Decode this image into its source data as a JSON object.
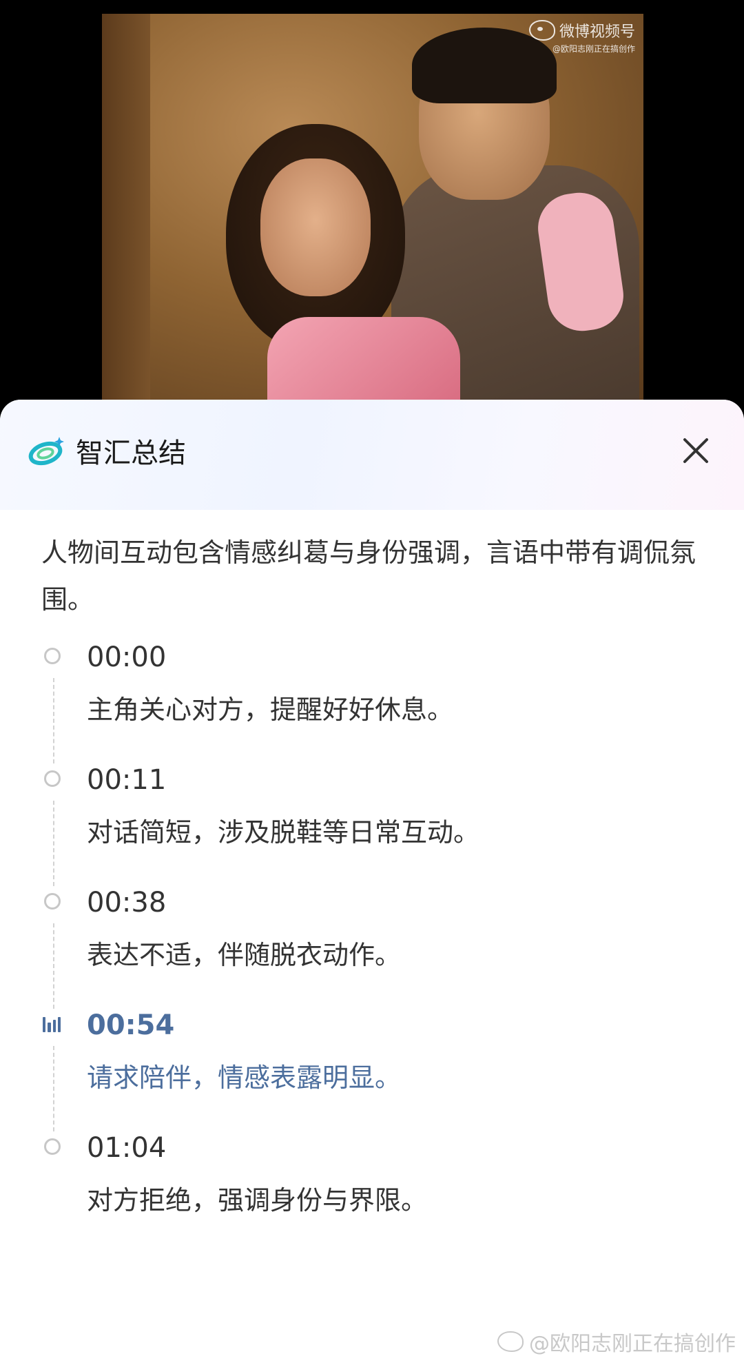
{
  "video": {
    "watermark_brand": "微博视频号",
    "watermark_handle": "@欧阳志刚正在搞创作"
  },
  "sheet": {
    "title": "智汇总结",
    "summary": "人物间互动包含情感纠葛与身份强调，言语中带有调侃氛围。",
    "timeline": [
      {
        "time": "00:00",
        "text": "主角关心对方，提醒好好休息。"
      },
      {
        "time": "00:11",
        "text": "对话简短，涉及脱鞋等日常互动。"
      },
      {
        "time": "00:38",
        "text": "表达不适，伴随脱衣动作。"
      },
      {
        "time": "00:54",
        "text": "请求陪伴，情感表露明显。"
      },
      {
        "time": "01:04",
        "text": "对方拒绝，强调身份与界限。"
      }
    ],
    "active_index": 3
  },
  "footer": {
    "watermark": "@欧阳志刚正在搞创作"
  },
  "colors": {
    "accent": "#4c6e9d",
    "logo_primary": "#1fb5c9"
  },
  "icons": {
    "logo": "zhihui-logo-icon",
    "close": "close-icon",
    "playing": "playing-bars-icon"
  }
}
